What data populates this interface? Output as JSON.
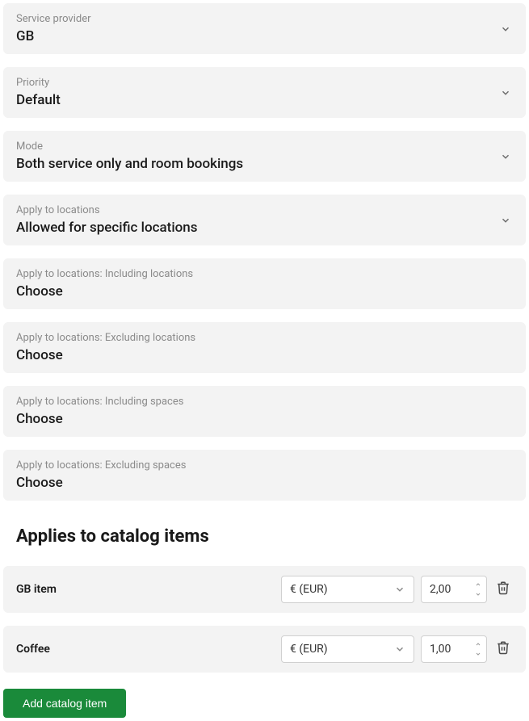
{
  "fields": {
    "serviceProvider": {
      "label": "Service provider",
      "value": "GB"
    },
    "priority": {
      "label": "Priority",
      "value": "Default"
    },
    "mode": {
      "label": "Mode",
      "value": "Both service only and room bookings"
    },
    "applyLocations": {
      "label": "Apply to locations",
      "value": "Allowed for specific locations"
    },
    "includingLocations": {
      "label": "Apply to locations: Including locations",
      "value": "Choose"
    },
    "excludingLocations": {
      "label": "Apply to locations: Excluding locations",
      "value": "Choose"
    },
    "includingSpaces": {
      "label": "Apply to locations: Including spaces",
      "value": "Choose"
    },
    "excludingSpaces": {
      "label": "Apply to locations: Excluding spaces",
      "value": "Choose"
    }
  },
  "catalogSection": {
    "heading": "Applies to catalog items"
  },
  "catalogItems": [
    {
      "name": "GB item",
      "currency": "€ (EUR)",
      "price": "2,00"
    },
    {
      "name": "Coffee",
      "currency": "€ (EUR)",
      "price": "1,00"
    }
  ],
  "addButton": "Add catalog item"
}
